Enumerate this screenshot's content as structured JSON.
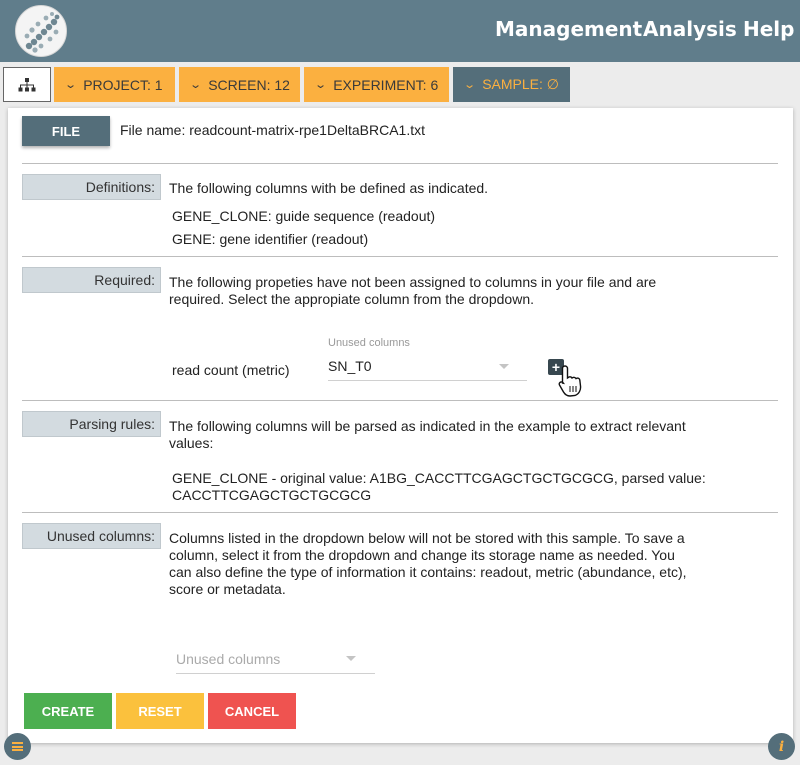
{
  "nav": {
    "links": [
      "Management",
      "Analysis",
      "Help"
    ]
  },
  "breadcrumb": {
    "project": "PROJECT: 1",
    "screen": "SCREEN: 12",
    "experiment": "EXPERIMENT: 6",
    "sample": "SAMPLE: ∅"
  },
  "file": {
    "button_label": "FILE",
    "name_text": "File name: readcount-matrix-rpe1DeltaBRCA1.txt"
  },
  "definitions": {
    "label": "Definitions:",
    "intro": "The following columns with be defined as indicated.",
    "items": [
      "GENE_CLONE: guide sequence (readout)",
      "GENE: gene identifier (readout)"
    ]
  },
  "required": {
    "label": "Required:",
    "intro_line1": "The following propeties have not been assigned to columns in your file and are",
    "intro_line2": "required. Select the appropiate column from the dropdown.",
    "field_label": "read count (metric)",
    "dropdown_label": "Unused columns",
    "dropdown_value": "SN_T0"
  },
  "parsing": {
    "label": "Parsing rules:",
    "intro_line1": "The following columns will be parsed as indicated in the example to extract relevant",
    "intro_line2": "values:",
    "example_line1": "GENE_CLONE - original value: A1BG_CACCTTCGAGCTGCTGCGCG, parsed value:",
    "example_line2": "CACCTTCGAGCTGCTGCGCG"
  },
  "unused": {
    "label": "Unused columns:",
    "text_line1": "Columns listed in the dropdown below will not be stored with this sample. To save a",
    "text_line2": "column, select it from the dropdown and change its storage name as needed. You",
    "text_line3": "can also define the type of information it contains: readout, metric (abundance, etc),",
    "text_line4": "score or metadata.",
    "dropdown_placeholder": "Unused columns"
  },
  "actions": {
    "create": "CREATE",
    "reset": "RESET",
    "cancel": "CANCEL"
  },
  "colors": {
    "header": "#607d8b",
    "accent_orange": "#fbb040",
    "create": "#4caf50",
    "reset": "#fbc13d",
    "cancel": "#ef5350"
  }
}
